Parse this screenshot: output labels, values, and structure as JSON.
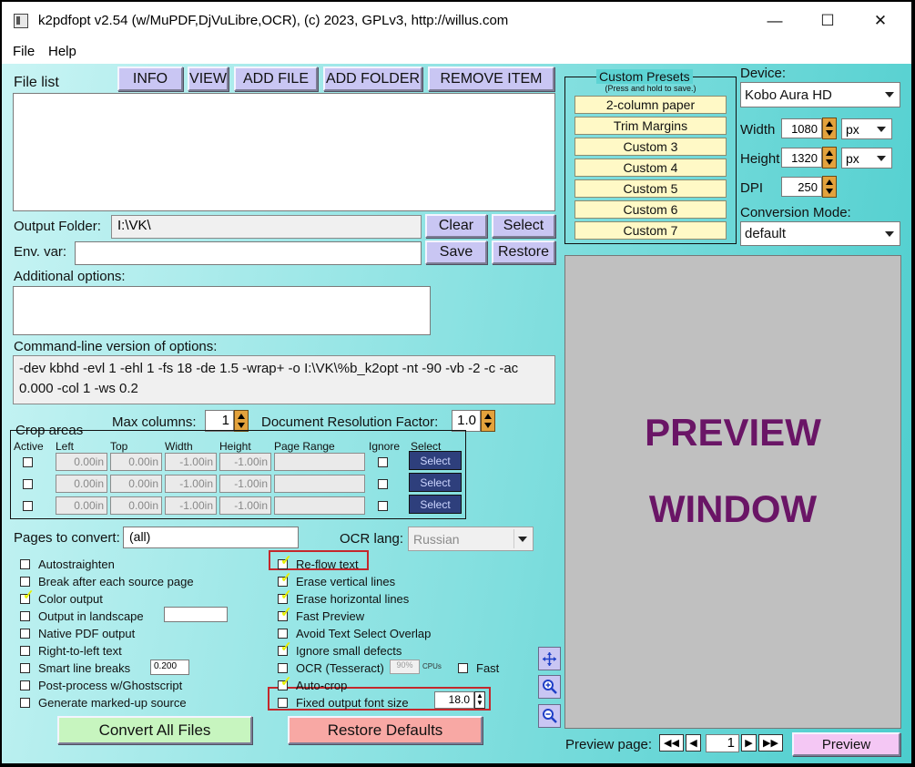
{
  "window": {
    "title": "k2pdfopt v2.54 (w/MuPDF,DjVuLibre,OCR), (c) 2023, GPLv3, http://willus.com",
    "minimize_glyph": "—",
    "maximize_glyph": "☐",
    "close_glyph": "✕"
  },
  "menu": [
    "File",
    "Help"
  ],
  "file_list": {
    "label": "File list",
    "buttons": {
      "info": "INFO",
      "view": "VIEW",
      "add_file": "ADD FILE",
      "add_folder": "ADD FOLDER",
      "remove_item": "REMOVE ITEM"
    }
  },
  "output_folder": {
    "label": "Output Folder:",
    "value": "I:\\VK\\",
    "clear": "Clear",
    "select": "Select"
  },
  "env_var": {
    "label": "Env. var:",
    "value": "",
    "save": "Save",
    "restore": "Restore"
  },
  "additional_options": {
    "label": "Additional options:",
    "value": ""
  },
  "command_line": {
    "label": "Command-line version of options:",
    "line1": "-dev kbhd -evl 1 -ehl 1 -fs 18 -de 1.5 -wrap+ -o I:\\VK\\%b_k2opt -nt -90 -vb -2 -c -ac",
    "line2": "0.000 -col 1 -ws 0.2"
  },
  "max_columns": {
    "label": "Max columns:",
    "value": "1"
  },
  "doc_resolution": {
    "label": "Document Resolution Factor:",
    "value": "1.0"
  },
  "crop_areas": {
    "title": "Crop areas",
    "headers": [
      "Active",
      "Left",
      "Top",
      "Width",
      "Height",
      "Page Range",
      "Ignore",
      "Select"
    ],
    "rows": [
      {
        "left": "0.00in",
        "top": "0.00in",
        "width": "-1.00in",
        "height": "-1.00in",
        "range": "",
        "select": "Select"
      },
      {
        "left": "0.00in",
        "top": "0.00in",
        "width": "-1.00in",
        "height": "-1.00in",
        "range": "",
        "select": "Select"
      },
      {
        "left": "0.00in",
        "top": "0.00in",
        "width": "-1.00in",
        "height": "-1.00in",
        "range": "",
        "select": "Select"
      }
    ]
  },
  "pages_to_convert": {
    "label": "Pages to convert:",
    "value": "(all)"
  },
  "ocr_lang": {
    "label": "OCR lang:",
    "value": "Russian"
  },
  "left_options": [
    {
      "label": "Autostraighten",
      "checked": false
    },
    {
      "label": "Break after each source page",
      "checked": false
    },
    {
      "label": "Color output",
      "checked": true
    },
    {
      "label": "Output in landscape",
      "checked": false
    },
    {
      "label": "Native PDF output",
      "checked": false
    },
    {
      "label": "Right-to-left text",
      "checked": false
    },
    {
      "label": "Smart line breaks",
      "checked": false
    },
    {
      "label": "Post-process w/Ghostscript",
      "checked": false
    },
    {
      "label": "Generate marked-up source",
      "checked": false
    }
  ],
  "smart_line_breaks_value": "0.200",
  "right_options": [
    {
      "label": "Re-flow text",
      "checked": true
    },
    {
      "label": "Erase vertical lines",
      "checked": true
    },
    {
      "label": "Erase horizontal lines",
      "checked": true
    },
    {
      "label": "Fast Preview",
      "checked": true
    },
    {
      "label": "Avoid Text Select Overlap",
      "checked": false
    },
    {
      "label": "Ignore small defects",
      "checked": true
    },
    {
      "label": "OCR (Tesseract)",
      "checked": false
    },
    {
      "label": "Auto-crop",
      "checked": true
    },
    {
      "label": "Fixed output font size",
      "checked": false
    }
  ],
  "ocr_cpus": {
    "value": "90%",
    "unit": "CPUs",
    "fast_label": "Fast",
    "fast_checked": false
  },
  "fixed_font_size_value": "18.0",
  "convert_all": "Convert All Files",
  "restore_defaults": "Restore Defaults",
  "presets": {
    "title": "Custom Presets",
    "subtitle": "(Press and hold to save.)",
    "items": [
      "2-column paper",
      "Trim Margins",
      "Custom 3",
      "Custom 4",
      "Custom 5",
      "Custom 6",
      "Custom 7"
    ]
  },
  "device": {
    "label": "Device:",
    "value": "Kobo Aura HD",
    "width_label": "Width",
    "width": "1080",
    "width_unit": "px",
    "height_label": "Height",
    "height": "1320",
    "height_unit": "px",
    "dpi_label": "DPI",
    "dpi": "250",
    "conversion_label": "Conversion Mode:",
    "conversion": "default"
  },
  "preview": {
    "line1": "PREVIEW",
    "line2": "WINDOW",
    "page_label": "Preview page:",
    "page_value": "1",
    "button": "Preview",
    "text_color": "#6a1566",
    "bg_color": "#c0c0c0"
  },
  "icons": [
    "move-icon",
    "zoom-in-icon",
    "zoom-out-icon",
    "first-page-icon",
    "prev-page-icon",
    "next-page-icon",
    "last-page-icon"
  ]
}
